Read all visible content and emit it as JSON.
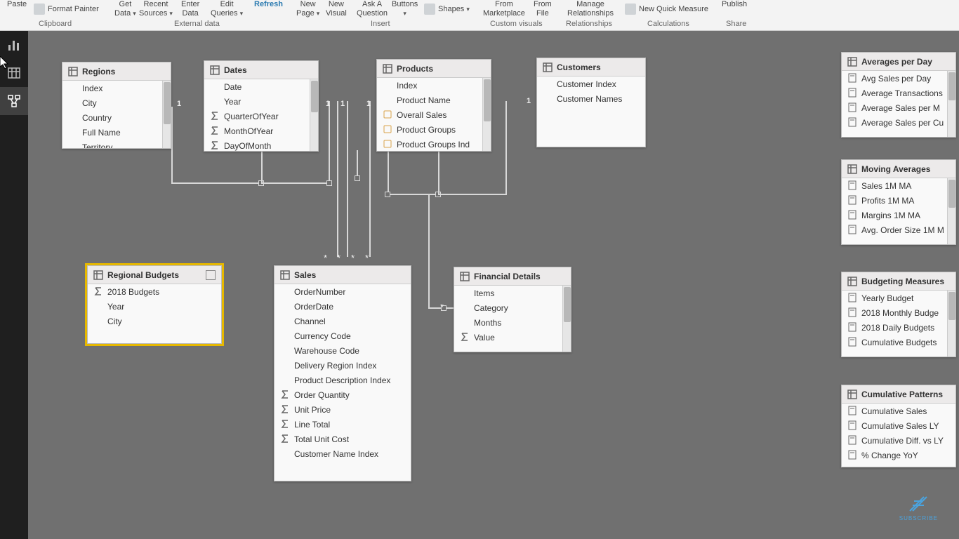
{
  "ribbon": {
    "paste": "Paste",
    "format_painter": "Format Painter",
    "get_data": "Get Data",
    "recent_sources": "Recent Sources",
    "enter_data": "Enter Data",
    "edit_queries": "Edit Queries",
    "refresh": "Refresh",
    "new_page": "New Page",
    "new_visual": "New Visual",
    "ask_question": "Ask A Question",
    "buttons": "Buttons",
    "shapes": "Shapes",
    "from_marketplace": "From Marketplace",
    "from_file": "From File",
    "manage_relationships": "Manage Relationships",
    "new_quick_measure": "New Quick Measure",
    "publish": "Publish",
    "grp_clipboard": "Clipboard",
    "grp_external": "External data",
    "grp_insert": "Insert",
    "grp_custom": "Custom visuals",
    "grp_rel": "Relationships",
    "grp_calc": "Calculations",
    "grp_share": "Share"
  },
  "tables": {
    "regions": {
      "title": "Regions",
      "fields": [
        "Index",
        "City",
        "Country",
        "Full Name",
        "Territory"
      ]
    },
    "dates": {
      "title": "Dates",
      "fields": [
        "Date",
        "Year",
        "QuarterOfYear",
        "MonthOfYear",
        "DayOfMonth"
      ]
    },
    "products": {
      "title": "Products",
      "fields": [
        "Index",
        "Product Name",
        "Overall Sales",
        "Product Groups",
        "Product Groups Ind"
      ]
    },
    "customers": {
      "title": "Customers",
      "fields": [
        "Customer Index",
        "Customer Names"
      ]
    },
    "regional_budgets": {
      "title": "Regional Budgets",
      "fields": [
        "2018 Budgets",
        "Year",
        "City"
      ]
    },
    "sales": {
      "title": "Sales",
      "fields": [
        "OrderNumber",
        "OrderDate",
        "Channel",
        "Currency Code",
        "Warehouse Code",
        "Delivery Region Index",
        "Product Description Index",
        "Order Quantity",
        "Unit Price",
        "Line Total",
        "Total Unit Cost",
        "Customer Name Index"
      ]
    },
    "financial": {
      "title": "Financial Details",
      "fields": [
        "Items",
        "Category",
        "Months",
        "Value"
      ]
    },
    "avg_day": {
      "title": "Averages per Day",
      "fields": [
        "Avg Sales per Day",
        "Average Transactions",
        "Average Sales per M",
        "Average Sales per Cu"
      ]
    },
    "moving_avg": {
      "title": "Moving Averages",
      "fields": [
        "Sales 1M MA",
        "Profits 1M MA",
        "Margins 1M MA",
        "Avg. Order Size 1M M"
      ]
    },
    "budgeting": {
      "title": "Budgeting Measures",
      "fields": [
        "Yearly Budget",
        "2018 Monthly Budge",
        "2018 Daily Budgets",
        "Cumulative Budgets"
      ]
    },
    "cumulative": {
      "title": "Cumulative Patterns",
      "fields": [
        "Cumulative Sales",
        "Cumulative Sales LY",
        "Cumulative Diff. vs LY",
        "% Change YoY"
      ]
    }
  },
  "subscribe": "SUBSCRIBE"
}
